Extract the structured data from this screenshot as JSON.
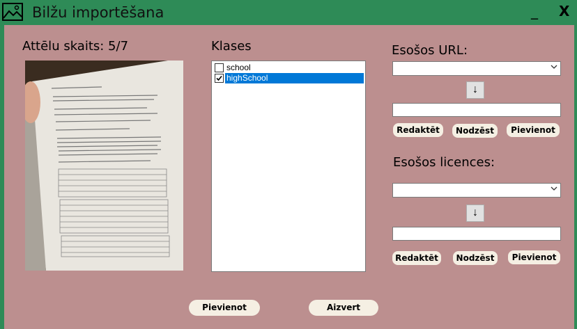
{
  "window": {
    "title": "Bilžu importēšana",
    "minimize_label": "_",
    "close_label": "X",
    "bg_color": "#2e8b57",
    "client_color": "#bc8f8f"
  },
  "image_panel": {
    "count_label": "Attēlu skaits: 5/7"
  },
  "classes": {
    "label": "Klases",
    "items": [
      {
        "label": "school",
        "checked": false,
        "selected": false
      },
      {
        "label": "highSchool",
        "checked": true,
        "selected": true
      }
    ]
  },
  "url_section": {
    "label": "Esošos URL:",
    "combo_value": "",
    "arrow_label": "↓",
    "input_value": "",
    "edit_label": "Redaktēt",
    "delete_label": "Nodzēst",
    "add_label": "Pievienot"
  },
  "license_section": {
    "label": "Esošos licences:",
    "combo_value": "",
    "arrow_label": "↓",
    "input_value": "",
    "edit_label": "Redaktēt",
    "delete_label": "Nodzēst",
    "add_label": "Pievienot"
  },
  "footer": {
    "add_label": "Pievienot",
    "close_label": "Aizvert"
  }
}
